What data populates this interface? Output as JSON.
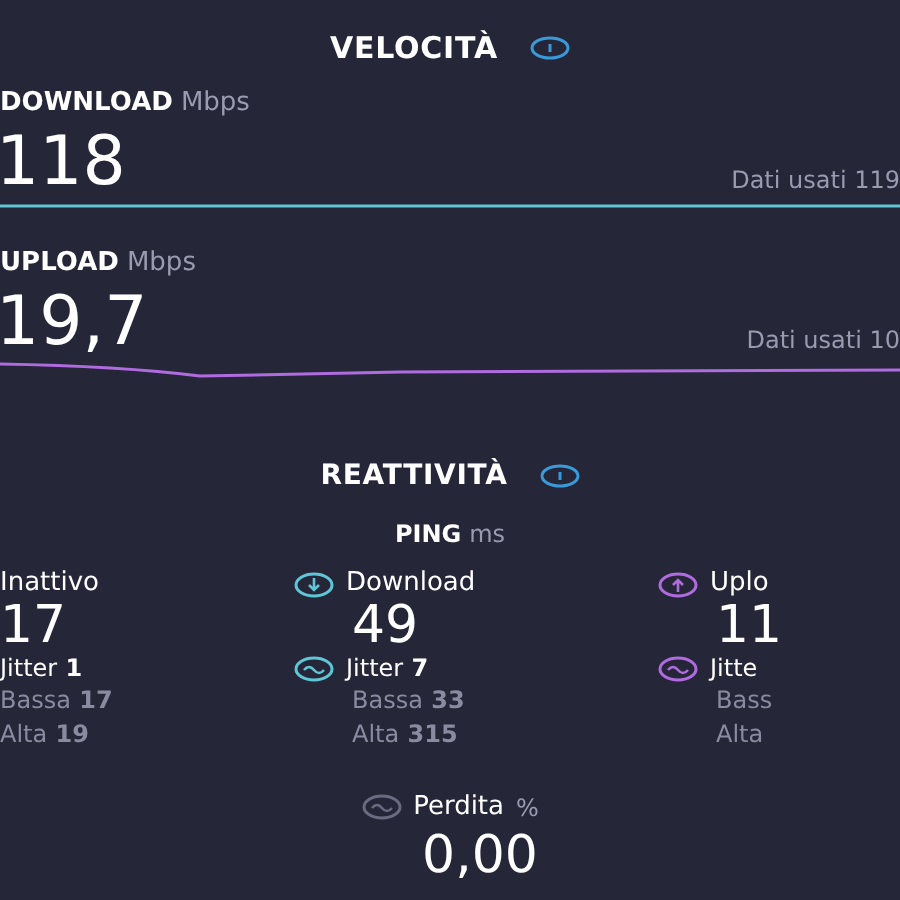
{
  "speed": {
    "title": "VELOCITÀ",
    "tests": [
      {
        "label": "DOWNLOAD",
        "unit": "Mbps",
        "value": "118",
        "data_used": "Dati usati 119",
        "color": "#5fc6d6"
      },
      {
        "label": "UPLOAD",
        "unit": "Mbps",
        "value": "19,7",
        "data_used": "Dati usati 10",
        "color": "#b06be0"
      }
    ]
  },
  "responsiveness": {
    "title": "REATTIVITÀ",
    "ping_label": "PING",
    "ping_unit": "ms",
    "columns": [
      {
        "label": "Inattivo",
        "value": "17",
        "jitter_label": "Jitter",
        "jitter": "1",
        "low_label": "Bassa",
        "low": "17",
        "high_label": "Alta",
        "high": "19"
      },
      {
        "label": "Download",
        "color": "#5fc6d6",
        "value": "49",
        "jitter_label": "Jitter",
        "jitter": "7",
        "low_label": "Bassa",
        "low": "33",
        "high_label": "Alta",
        "high": "315"
      },
      {
        "label": "Uplo",
        "color": "#b06be0",
        "value": "11",
        "jitter_label": "Jitte",
        "low_label": "Bass",
        "high_label": "Alta"
      }
    ],
    "loss_label": "Perdita",
    "loss_unit": "%",
    "loss": "0,00"
  }
}
